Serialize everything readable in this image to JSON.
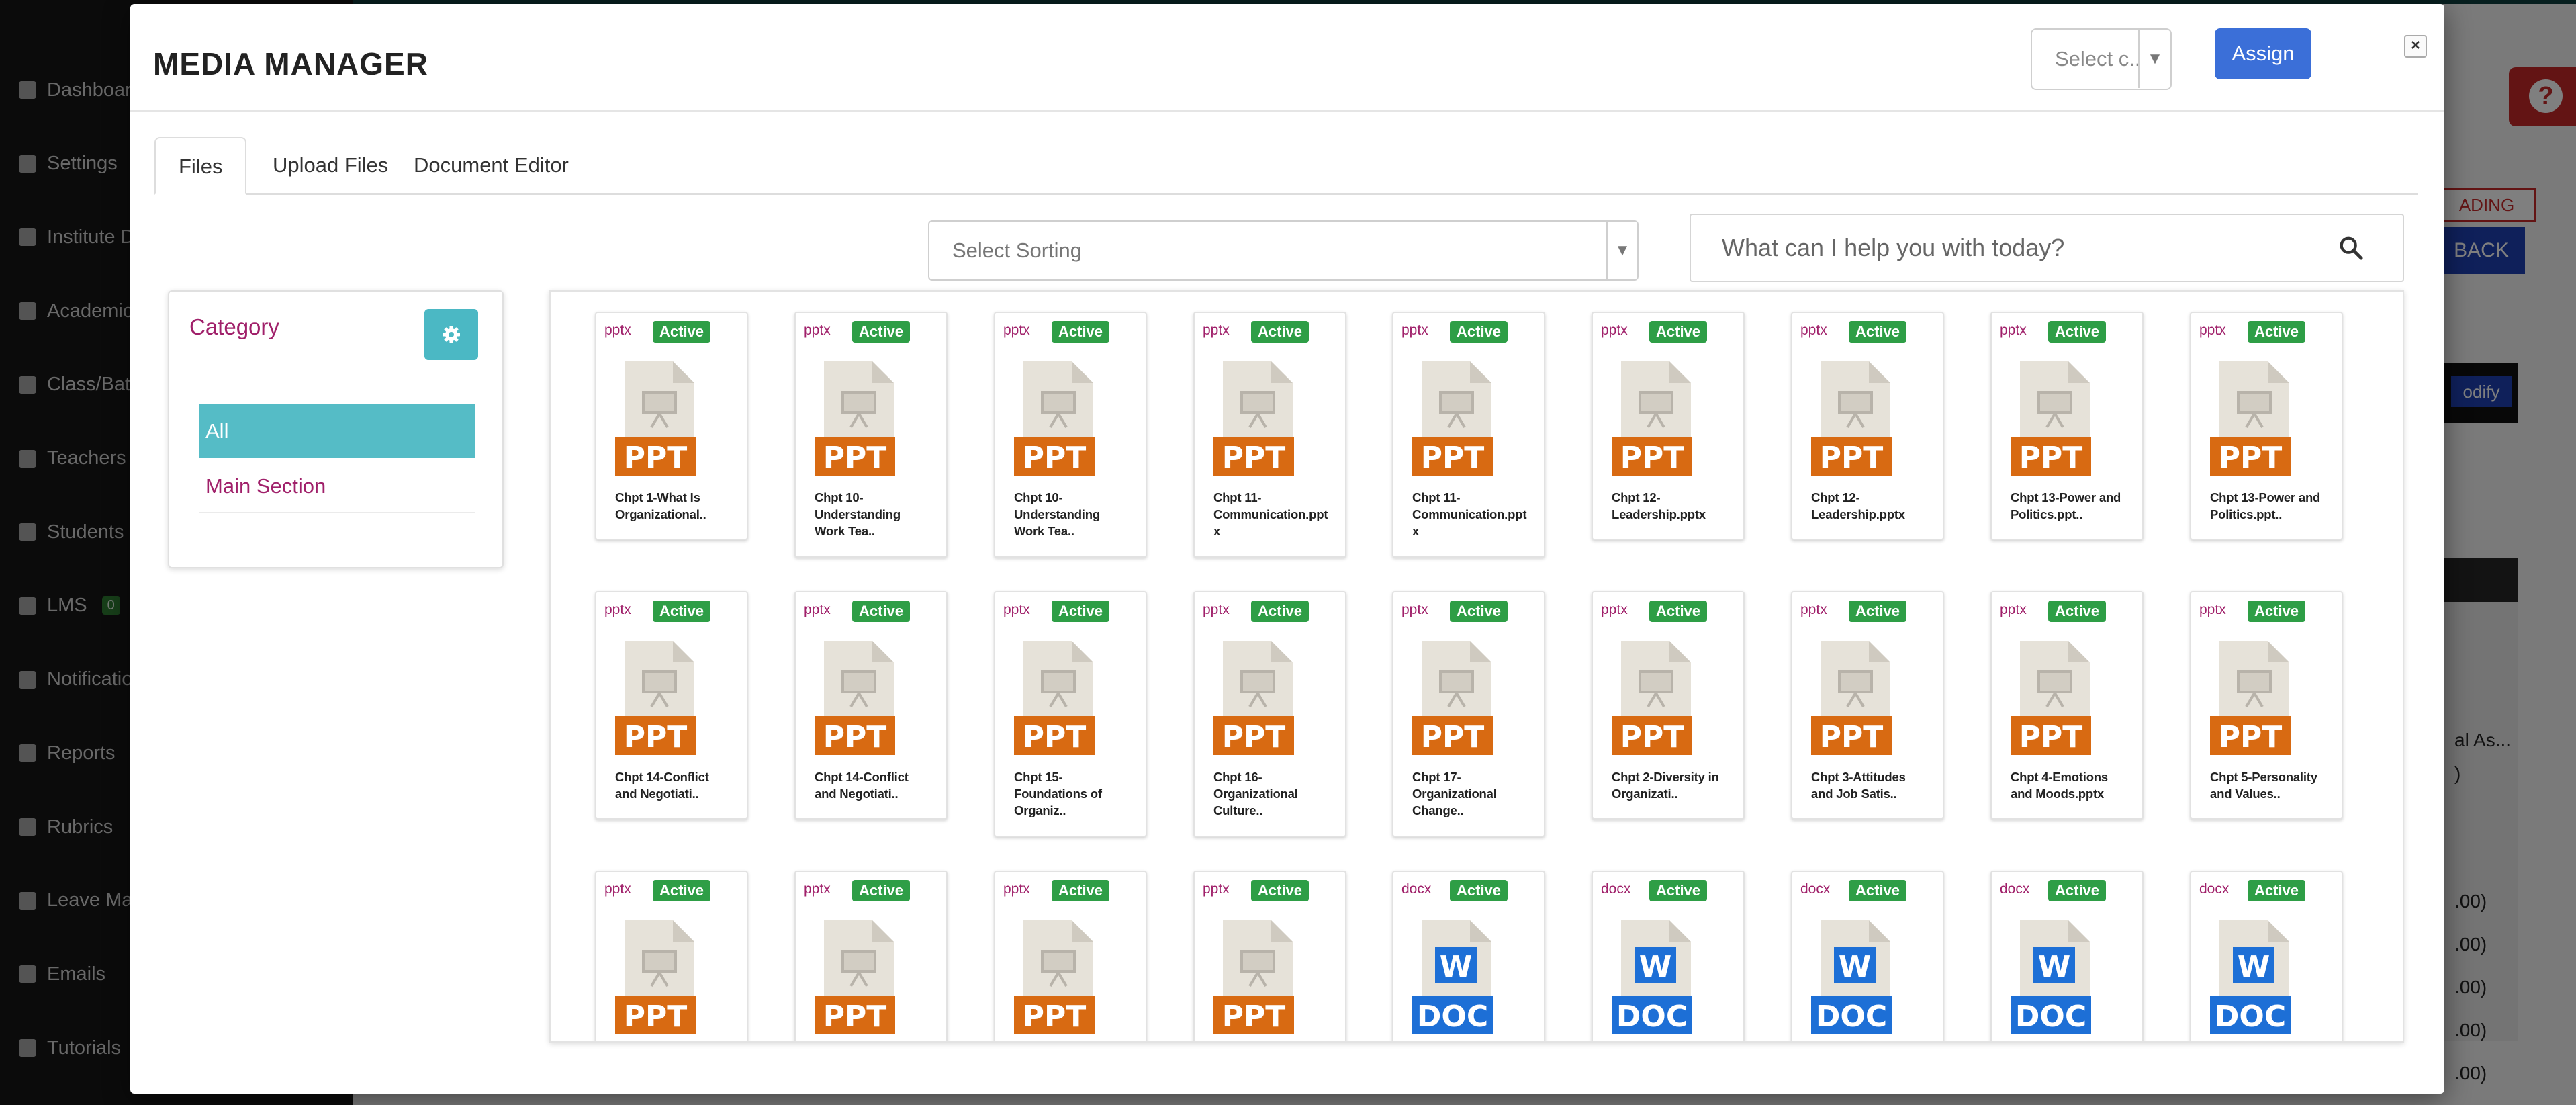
{
  "sidebar": {
    "items": [
      {
        "label": "Dashboard"
      },
      {
        "label": "Settings"
      },
      {
        "label": "Institute D"
      },
      {
        "label": "Academic"
      },
      {
        "label": "Class/Bat"
      },
      {
        "label": "Teachers"
      },
      {
        "label": "Students"
      },
      {
        "label": "LMS",
        "badge": "0"
      },
      {
        "label": "Notificatio"
      },
      {
        "label": "Reports"
      },
      {
        "label": "Rubrics"
      },
      {
        "label": "Leave Ma"
      },
      {
        "label": "Emails"
      },
      {
        "label": "Tutorials"
      }
    ]
  },
  "background": {
    "help_label": "?",
    "tag_label": "ADING",
    "back_label": "BACK",
    "modify_label": "odify",
    "row_a": "al As...",
    "row_b": ")",
    "values": [
      ".00)",
      ".00)",
      ".00)",
      ".00)",
      ".00)"
    ]
  },
  "modal": {
    "title": "MEDIA MANAGER",
    "select_placeholder": "Select c...",
    "assign_label": "Assign",
    "close_label": "×",
    "tabs": [
      {
        "label": "Files",
        "active": true
      },
      {
        "label": "Upload Files",
        "active": false
      },
      {
        "label": "Document Editor",
        "active": false
      }
    ],
    "sorting_placeholder": "Select Sorting",
    "search_placeholder": "What can I help you with today?"
  },
  "category": {
    "title": "Category",
    "items": [
      {
        "label": "All",
        "active": true
      },
      {
        "label": "Main Section",
        "active": false
      }
    ]
  },
  "colors": {
    "accent_blue": "#3b6fd8",
    "teal": "#4bb8c4",
    "magenta": "#a0206a",
    "active_green": "#2e9e46",
    "ppt_orange": "#d86a12",
    "doc_blue": "#1d6fd6"
  },
  "files": [
    {
      "ext": "pptx",
      "status": "Active",
      "kind": "ppt",
      "name_lines": [
        "Chpt 1-What Is",
        "Organizational.."
      ]
    },
    {
      "ext": "pptx",
      "status": "Active",
      "kind": "ppt",
      "name_lines": [
        "Chpt 10-",
        "Understanding",
        "Work Tea.."
      ]
    },
    {
      "ext": "pptx",
      "status": "Active",
      "kind": "ppt",
      "name_lines": [
        "Chpt 10-",
        "Understanding",
        "Work Tea.."
      ]
    },
    {
      "ext": "pptx",
      "status": "Active",
      "kind": "ppt",
      "name_lines": [
        "Chpt 11-",
        "Communication.ppt",
        "x"
      ]
    },
    {
      "ext": "pptx",
      "status": "Active",
      "kind": "ppt",
      "name_lines": [
        "Chpt 11-",
        "Communication.ppt",
        "x"
      ]
    },
    {
      "ext": "pptx",
      "status": "Active",
      "kind": "ppt",
      "name_lines": [
        "Chpt 12-",
        "Leadership.pptx"
      ]
    },
    {
      "ext": "pptx",
      "status": "Active",
      "kind": "ppt",
      "name_lines": [
        "Chpt 12-",
        "Leadership.pptx"
      ]
    },
    {
      "ext": "pptx",
      "status": "Active",
      "kind": "ppt",
      "name_lines": [
        "Chpt 13-Power and",
        "Politics.ppt.."
      ]
    },
    {
      "ext": "pptx",
      "status": "Active",
      "kind": "ppt",
      "name_lines": [
        "Chpt 13-Power and",
        "Politics.ppt.."
      ]
    },
    {
      "ext": "pptx",
      "status": "Active",
      "kind": "ppt",
      "name_lines": [
        "Chpt 14-Conflict",
        "and Negotiati.."
      ]
    },
    {
      "ext": "pptx",
      "status": "Active",
      "kind": "ppt",
      "name_lines": [
        "Chpt 14-Conflict",
        "and Negotiati.."
      ]
    },
    {
      "ext": "pptx",
      "status": "Active",
      "kind": "ppt",
      "name_lines": [
        "Chpt 15-",
        "Foundations of",
        "Organiz.."
      ]
    },
    {
      "ext": "pptx",
      "status": "Active",
      "kind": "ppt",
      "name_lines": [
        "Chpt 16-",
        "Organizational",
        "Culture.."
      ]
    },
    {
      "ext": "pptx",
      "status": "Active",
      "kind": "ppt",
      "name_lines": [
        "Chpt 17-",
        "Organizational",
        "Change.."
      ]
    },
    {
      "ext": "pptx",
      "status": "Active",
      "kind": "ppt",
      "name_lines": [
        "Chpt 2-Diversity in",
        "Organizati.."
      ]
    },
    {
      "ext": "pptx",
      "status": "Active",
      "kind": "ppt",
      "name_lines": [
        "Chpt 3-Attitudes",
        "and Job Satis.."
      ]
    },
    {
      "ext": "pptx",
      "status": "Active",
      "kind": "ppt",
      "name_lines": [
        "Chpt 4-Emotions",
        "and Moods.pptx"
      ]
    },
    {
      "ext": "pptx",
      "status": "Active",
      "kind": "ppt",
      "name_lines": [
        "Chpt 5-Personality",
        "and Values.."
      ]
    },
    {
      "ext": "pptx",
      "status": "Active",
      "kind": "ppt",
      "name_lines": []
    },
    {
      "ext": "pptx",
      "status": "Active",
      "kind": "ppt",
      "name_lines": []
    },
    {
      "ext": "pptx",
      "status": "Active",
      "kind": "ppt",
      "name_lines": []
    },
    {
      "ext": "pptx",
      "status": "Active",
      "kind": "ppt",
      "name_lines": []
    },
    {
      "ext": "docx",
      "status": "Active",
      "kind": "doc",
      "name_lines": []
    },
    {
      "ext": "docx",
      "status": "Active",
      "kind": "doc",
      "name_lines": []
    },
    {
      "ext": "docx",
      "status": "Active",
      "kind": "doc",
      "name_lines": []
    },
    {
      "ext": "docx",
      "status": "Active",
      "kind": "doc",
      "name_lines": []
    },
    {
      "ext": "docx",
      "status": "Active",
      "kind": "doc",
      "name_lines": []
    }
  ]
}
